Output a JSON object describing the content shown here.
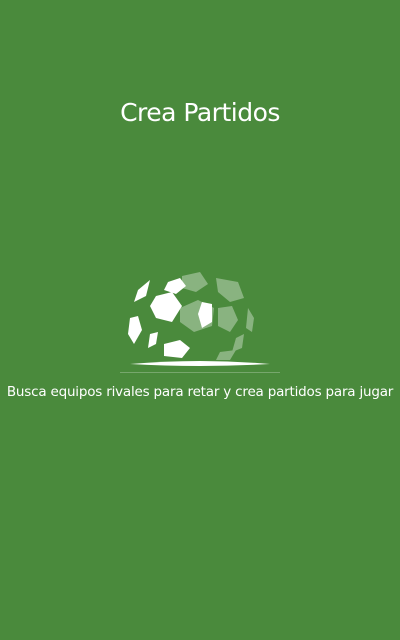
{
  "app": {
    "background_color": "#4a8a3c",
    "text_color": "#ffffff"
  },
  "onboarding": {
    "title": "Crea Partidos",
    "illustration_icon": "soccer-ball-icon",
    "description": "Busca equipos rivales para retar y crea partidos para jugar"
  }
}
